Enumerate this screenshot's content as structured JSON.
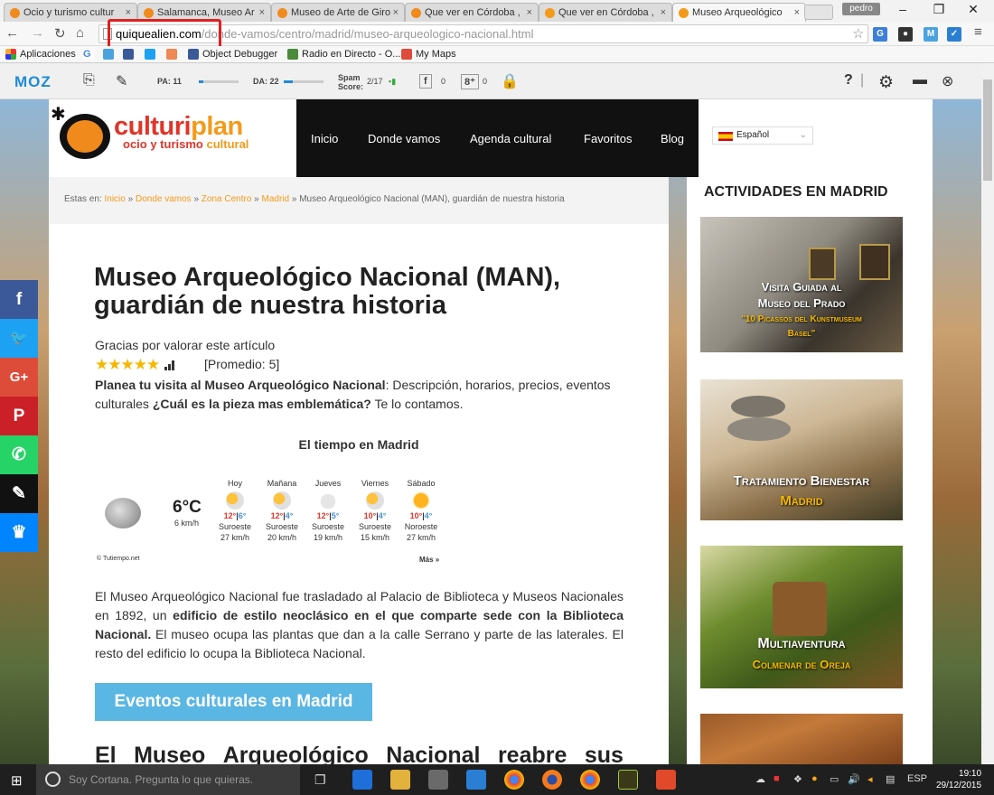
{
  "browser": {
    "tabs": [
      {
        "title": "Ocio y turismo cultur",
        "fav": "#f08a1c"
      },
      {
        "title": "Salamanca, Museo Ar",
        "fav": "#f08a1c"
      },
      {
        "title": "Museo de Arte de Giro",
        "fav": "#f08a1c"
      },
      {
        "title": "Que ver en Córdoba ,",
        "fav": "#f08a1c"
      },
      {
        "title": "Que ver en Córdoba ,",
        "fav": "#f39a1a"
      },
      {
        "title": "Museo Arqueológico",
        "fav": "#f39a1a"
      }
    ],
    "user": "pedro",
    "url_host": "quiquealien.com",
    "url_path": "/donde-vamos/centro/madrid/museo-arqueologico-nacional.html",
    "bookmarks": [
      "Aplicaciones",
      "Object Debugger",
      "Radio en Directo - O...",
      "My Maps"
    ]
  },
  "mozbar": {
    "logo": "MOZ",
    "pa_label": "PA: 11",
    "pa_value": 11,
    "da_label": "DA: 22",
    "da_value": 22,
    "spam_label": "Spam\nScore:",
    "spam_value": "2/17",
    "fb_count": "0",
    "gplus_count": "0",
    "help": "?"
  },
  "site": {
    "logo_main": "culturi",
    "logo_accent": "plan",
    "logo_sub_main": "ocio y turismo ",
    "logo_sub_accent": "cultural",
    "nav": [
      "Inicio",
      "Donde vamos",
      "Agenda cultural",
      "Favoritos",
      "Blog"
    ],
    "language": "Español"
  },
  "breadcrumb": {
    "prefix": "Estas en:",
    "links": [
      "Inicio",
      "Donde vamos",
      "Zona Centro",
      "Madrid"
    ],
    "separator": "»",
    "current": "Museo Arqueológico Nacional (MAN), guardián de nuestra historia"
  },
  "article": {
    "title": "Museo Arqueológico Nacional (MAN), guardián de nuestra historia",
    "rating_label": "Gracias por valorar este artículo",
    "rating_stars": "★★★★★",
    "rating_value": 5,
    "rating_avg": "[Promedio: 5]",
    "intro_bold1": "Planea tu visita al Museo Arqueológico Nacional",
    "intro_text1": ": Descripción, horarios, precios, eventos culturales ",
    "intro_bold2": "¿Cuál es la pieza mas emblemática?",
    "intro_text2": " Te lo contamos.",
    "body_1": "El Museo Arqueológico Nacional fue trasladado al Palacio de Biblioteca y Museos Nacionales en 1892, un ",
    "body_bold": "edificio de estilo neoclásico en el que comparte sede con la Biblioteca Nacional.",
    "body_2": " El museo ocupa las plantas que dan a la calle Serrano y parte de las laterales. El resto del edificio lo ocupa la Biblioteca Nacional.",
    "cta": "Eventos culturales en Madrid",
    "next_heading": [
      "El",
      "Museo",
      "Arqueológico",
      "Nacional",
      "reabre",
      "sus"
    ]
  },
  "weather": {
    "title": "El tiempo en Madrid",
    "current_temp": "6°C",
    "current_wind": "6 km/h",
    "credit": "© Tutiempo.net",
    "more": "Más »",
    "days": [
      {
        "name": "Hoy",
        "max": "12°",
        "min": "6°",
        "dir": "Suroeste",
        "speed": "27 km/h",
        "icon": "sun-cloud"
      },
      {
        "name": "Mañana",
        "max": "12°",
        "min": "4°",
        "dir": "Suroeste",
        "speed": "20 km/h",
        "icon": "sun-cloud"
      },
      {
        "name": "Jueves",
        "max": "12°",
        "min": "5°",
        "dir": "Suroeste",
        "speed": "19 km/h",
        "icon": "cloud"
      },
      {
        "name": "Viernes",
        "max": "10°",
        "min": "4°",
        "dir": "Suroeste",
        "speed": "15 km/h",
        "icon": "sun-cloud"
      },
      {
        "name": "Sábado",
        "max": "10°",
        "min": "4°",
        "dir": "Noroeste",
        "speed": "27 km/h",
        "icon": "sun"
      }
    ]
  },
  "sidebar": {
    "title": "ACTIVIDADES EN MADRID",
    "ads": [
      {
        "line1": "Visita Guiada al",
        "line2": "Museo del Prado",
        "line3": "\"10 Picassos del Kunstmuseum",
        "line4": "Basel\""
      },
      {
        "line1": "Tratamiento Bienestar",
        "line2": "Madrid"
      },
      {
        "line1": "Multiaventura",
        "line2": "Colmenar de Oreja"
      }
    ]
  },
  "share": [
    {
      "label": "f",
      "color": "#3b5998",
      "icon": "facebook-icon"
    },
    {
      "label": "🐦",
      "color": "#1da1f2",
      "icon": "twitter-icon"
    },
    {
      "label": "G+",
      "color": "#dd4b39",
      "icon": "googleplus-icon"
    },
    {
      "label": "P",
      "color": "#cb2027",
      "icon": "pinterest-icon"
    },
    {
      "label": "✆",
      "color": "#25d366",
      "icon": "whatsapp-icon"
    },
    {
      "label": "✎",
      "color": "#111111",
      "icon": "owl-icon"
    },
    {
      "label": "♛",
      "color": "#0084ff",
      "icon": "crown-icon"
    }
  ],
  "taskbar": {
    "search_placeholder": "Soy Cortana. Pregunta lo que quieras.",
    "lang": "ESP",
    "time": "19:10",
    "date": "29/12/2015"
  }
}
